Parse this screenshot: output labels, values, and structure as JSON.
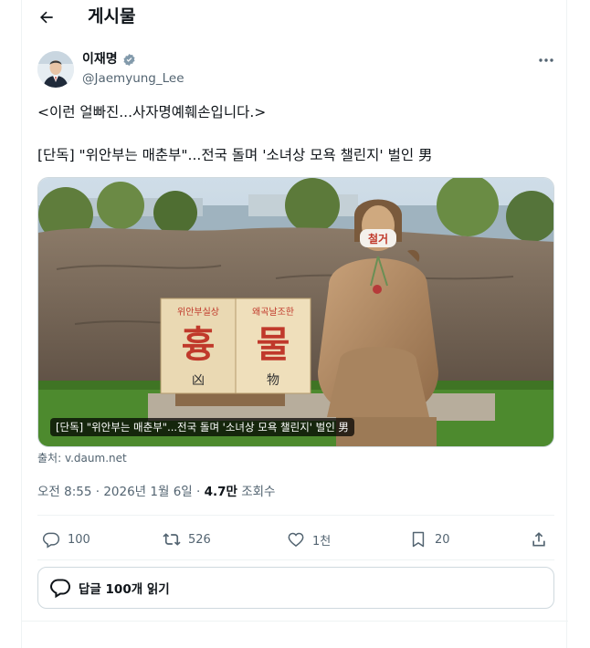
{
  "header": {
    "title": "게시물",
    "back_icon": "arrow-left-icon"
  },
  "author": {
    "name": "이재명",
    "handle": "@Jaemyung_Lee",
    "verified": true,
    "verified_color": "#829aab"
  },
  "post": {
    "line1": "<이런 얼빠진...사자명예훼손입니다.>",
    "line2": "[단독] \"위안부는 매춘부\"...전국 돌며 '소녀상 모욕 챌린지' 벌인 男"
  },
  "media": {
    "caption": "[단독] \"위안부는 매춘부\"...전국 돌며 '소녀상 모욕 챌린지' 벌인 男",
    "source": "출처: v.daum.net",
    "sign_left": {
      "small": "위안부실상",
      "big": "흉",
      "hanja": "凶"
    },
    "sign_right": {
      "small": "왜곡날조한",
      "big": "물",
      "hanja": "物"
    },
    "mask_text": "철거"
  },
  "meta": {
    "time": "오전 8:55 · 2026년 1월 6일 · ",
    "views": "4.7만",
    "views_label": " 조회수"
  },
  "actions": {
    "replies": "100",
    "reposts": "526",
    "likes": "1천",
    "bookmarks": "20"
  },
  "read_replies": {
    "label": "답글 100개 읽기"
  }
}
